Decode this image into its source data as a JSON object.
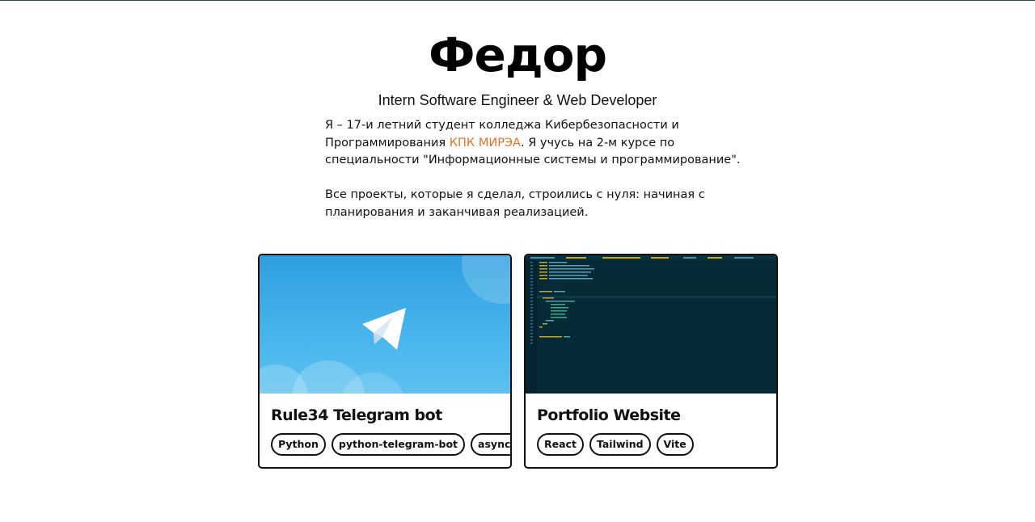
{
  "header": {
    "name": "Федор",
    "role": "Intern Software Engineer & Web Developer"
  },
  "bio": {
    "p1_before": "Я – 17-и летний студент колледжа Кибербезопасности и Программирования ",
    "p1_link": "КПК МИРЭА",
    "p1_after": ". Я учусь на 2-м курсе по специальности \"Информационные системы и программирование\".",
    "p2": "Все проекты, которые я сделал, строились с нуля: начиная с планирования и заканчивая реализацией."
  },
  "colors": {
    "accent": "#e8731f",
    "telegram_blue": "#2f9fe0",
    "editor_bg": "#062a36"
  },
  "projects": [
    {
      "title": "Rule34 Telegram bot",
      "image": "telegram-logo",
      "tags": [
        "Python",
        "python-telegram-bot",
        "asyncio"
      ]
    },
    {
      "title": "Portfolio Website",
      "image": "code-editor-screenshot",
      "tags": [
        "React",
        "Tailwind",
        "Vite"
      ]
    }
  ]
}
